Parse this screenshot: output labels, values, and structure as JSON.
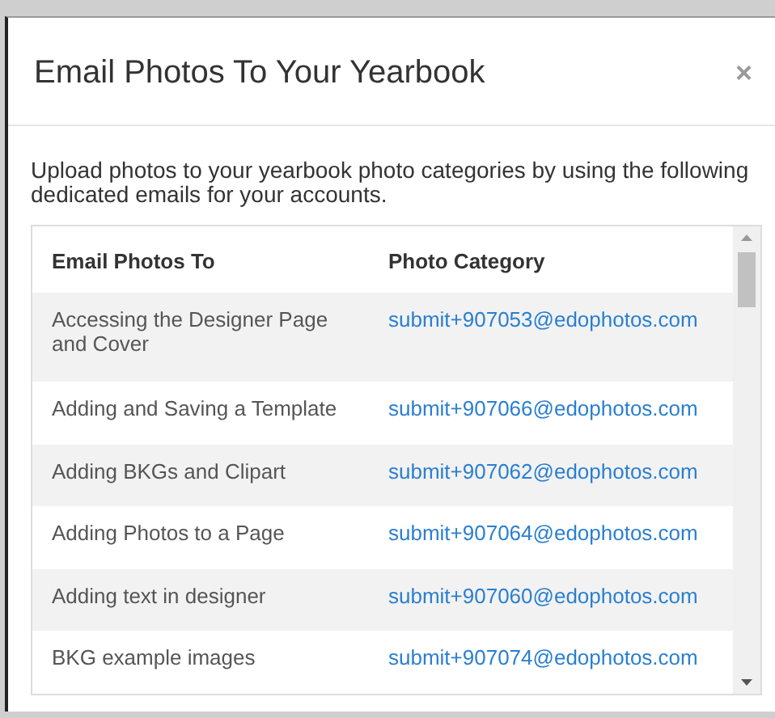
{
  "modal": {
    "title": "Email Photos To Your Yearbook",
    "close": "×"
  },
  "intro": "Upload photos to your yearbook photo categories by using the following dedicated emails for your accounts.",
  "table": {
    "columns": [
      "Email Photos To",
      "Photo Category"
    ],
    "rows": [
      {
        "category": "Accessing the Designer Page and Cover",
        "email": "submit+907053@edophotos.com"
      },
      {
        "category": "Adding and Saving a Template",
        "email": "submit+907066@edophotos.com"
      },
      {
        "category": "Adding BKGs and Clipart",
        "email": "submit+907062@edophotos.com"
      },
      {
        "category": "Adding Photos to a Page",
        "email": "submit+907064@edophotos.com"
      },
      {
        "category": "Adding text in designer",
        "email": "submit+907060@edophotos.com"
      },
      {
        "category": "BKG example images",
        "email": "submit+907074@edophotos.com"
      }
    ]
  }
}
